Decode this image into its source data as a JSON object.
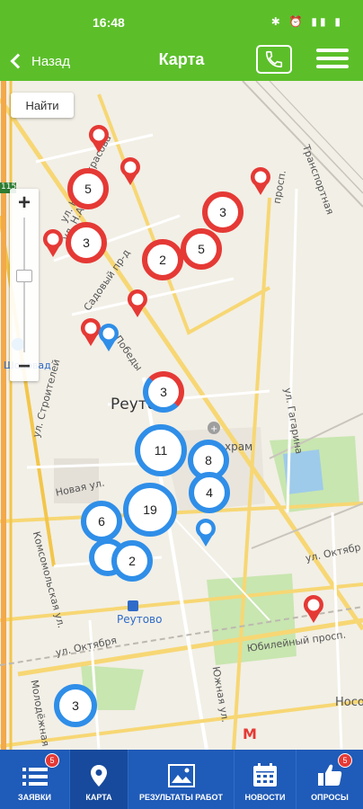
{
  "status_bar": {
    "time": "16:48",
    "icons": "✱ ⏰ ▮▮ ▮"
  },
  "app_bar": {
    "back_label": "Назад",
    "title": "Карта"
  },
  "map": {
    "search_button": "Найти",
    "labels": {
      "street_nekrasova_1": "ул. Н.А. Некрасова",
      "street_na": "ул. Н.А.",
      "street_sadovy": "Садовый пр-д",
      "street_pobedy": "Победы",
      "street_stroiteley": "ул. Строителей",
      "street_novaya": "Новая ул.",
      "street_komsomolskaya": "Комсомольская ул.",
      "street_oktyabrya": "ул. Октября",
      "street_oktyabrya_2": "ул. Октябр",
      "street_molodezhnaya": "Молодёжная",
      "street_yuzhnaya": "Южная ул.",
      "street_yubileiny": "Юбилейный просп.",
      "street_nosovi": "Носови",
      "street_transport": "Транспортная",
      "street_gagarina": "ул. Гагарина",
      "street_prosp": "просп.",
      "city": "Реутов",
      "church": "храм",
      "station": "Реутово",
      "shop": "Шоковад",
      "road_num": "115"
    },
    "clusters": [
      {
        "id": "c1",
        "count": "5",
        "type": "red"
      },
      {
        "id": "c2",
        "count": "3",
        "type": "red"
      },
      {
        "id": "c3",
        "count": "3",
        "type": "red"
      },
      {
        "id": "c4",
        "count": "2",
        "type": "red"
      },
      {
        "id": "c5",
        "count": "5",
        "type": "red"
      },
      {
        "id": "c6",
        "count": "3",
        "type": "mixed"
      },
      {
        "id": "c7",
        "count": "11",
        "type": "blue"
      },
      {
        "id": "c8",
        "count": "8",
        "type": "blue"
      },
      {
        "id": "c9",
        "count": "4",
        "type": "blue"
      },
      {
        "id": "c10",
        "count": "19",
        "type": "blue"
      },
      {
        "id": "c11",
        "count": "6",
        "type": "blue"
      },
      {
        "id": "c12",
        "count": "2",
        "type": "blue"
      },
      {
        "id": "c13",
        "count": "3",
        "type": "blue"
      }
    ],
    "colors": {
      "red": "#e53935",
      "blue": "#2f8ee8",
      "road_yellow": "#f7d774",
      "green_area": "#c8e6b0",
      "water": "#9ecbea"
    }
  },
  "bottom_nav": {
    "items": [
      {
        "label": "ЗАЯВКИ",
        "icon": "list-icon",
        "badge": "5"
      },
      {
        "label": "КАРТА",
        "icon": "map-pin-icon",
        "badge": ""
      },
      {
        "label": "РЕЗУЛЬТАТЫ РАБОТ",
        "icon": "image-icon",
        "badge": ""
      },
      {
        "label": "НОВОСТИ",
        "icon": "calendar-icon",
        "badge": ""
      },
      {
        "label": "ОПРОСЫ",
        "icon": "thumbs-up-icon",
        "badge": "5"
      }
    ]
  }
}
